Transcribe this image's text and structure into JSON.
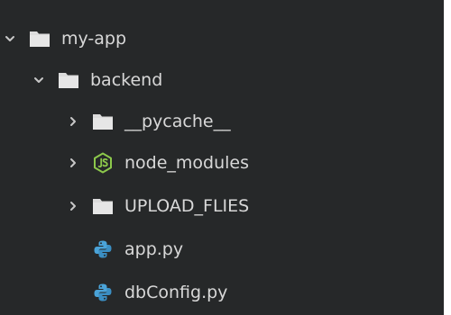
{
  "tree": {
    "root": {
      "label": "my-app",
      "expanded": true,
      "icon": "folder-icon"
    },
    "backend": {
      "label": "backend",
      "expanded": true,
      "icon": "folder-icon"
    },
    "items": [
      {
        "label": "__pycache__",
        "type": "folder",
        "expanded": false,
        "icon": "folder-icon"
      },
      {
        "label": "node_modules",
        "type": "folder",
        "expanded": false,
        "icon": "nodejs-folder-icon"
      },
      {
        "label": "UPLOAD_FLIES",
        "type": "folder",
        "expanded": false,
        "icon": "folder-icon"
      },
      {
        "label": "app.py",
        "type": "file",
        "icon": "python-file-icon"
      },
      {
        "label": "dbConfig.py",
        "type": "file",
        "icon": "python-file-icon"
      }
    ]
  },
  "colors": {
    "background": "#262829",
    "text": "#d8d8d8",
    "folder": "#dcdcdc",
    "chevron": "#c8c8c8",
    "nodejs": "#8cc84b",
    "python": "#4aa3d8"
  }
}
